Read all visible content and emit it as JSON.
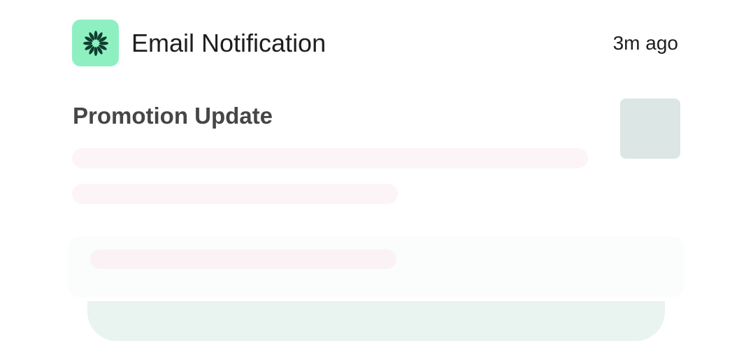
{
  "notification": {
    "app_icon": "flower-burst-icon",
    "app_name": "Email Notification",
    "timestamp": "3m ago",
    "title": "Promotion Update"
  },
  "colors": {
    "app_icon_bg": "#8ef0c0",
    "app_icon_fg": "#0f3d2f",
    "title_text": "#464646",
    "skeleton": "#fcf4f6",
    "thumbnail": "#dbe6e5",
    "stack_card_bottom": "#e9f3ef"
  }
}
